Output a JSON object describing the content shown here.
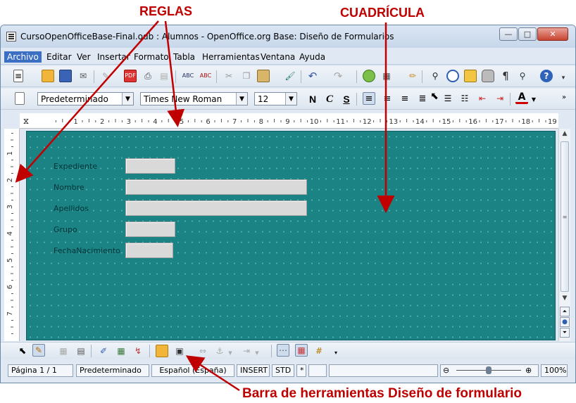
{
  "annotations": {
    "rulers": "REGLAS",
    "grid": "CUADRÍCULA",
    "form_toolbar": "Barra de herramientas Diseño de formulario"
  },
  "window": {
    "title": "CursoOpenOfficeBase-Final.odb : Alumnos - OpenOffice.org Base: Diseño de Formularios"
  },
  "menu": [
    "Archivo",
    "Editar",
    "Ver",
    "Insertar",
    "Formato",
    "Tabla",
    "Herramientas",
    "Ventana",
    "Ayuda"
  ],
  "format_toolbar": {
    "style": "Predeterminado",
    "font": "Times New Roman",
    "size": "12",
    "bold": "N",
    "italic": "C",
    "underline": "S"
  },
  "ruler": {
    "h_numbers": [
      "1",
      "2",
      "3",
      "4",
      "5",
      "6",
      "7",
      "8",
      "9",
      "10",
      "11",
      "12",
      "13",
      "14",
      "15",
      "16",
      "17",
      "18",
      "19"
    ],
    "v_numbers": [
      "1",
      "2",
      "3",
      "4",
      "5",
      "6",
      "7"
    ]
  },
  "form": {
    "fields": [
      {
        "label": "Expediente",
        "value": ""
      },
      {
        "label": "Nombre",
        "value": ""
      },
      {
        "label": "Apellidos",
        "value": ""
      },
      {
        "label": "Grupo",
        "value": ""
      },
      {
        "label": "FechaNacimiento",
        "value": ""
      }
    ]
  },
  "statusbar": {
    "page": "Página  1 / 1",
    "style": "Predeterminado",
    "language": "Español (España)",
    "insert": "INSERT",
    "std": "STD",
    "modified": "*",
    "zoom": "100%"
  },
  "colors": {
    "annotation": "#c00000",
    "grid_background": "#1b8383",
    "menu_active": "#3b6fc4"
  }
}
